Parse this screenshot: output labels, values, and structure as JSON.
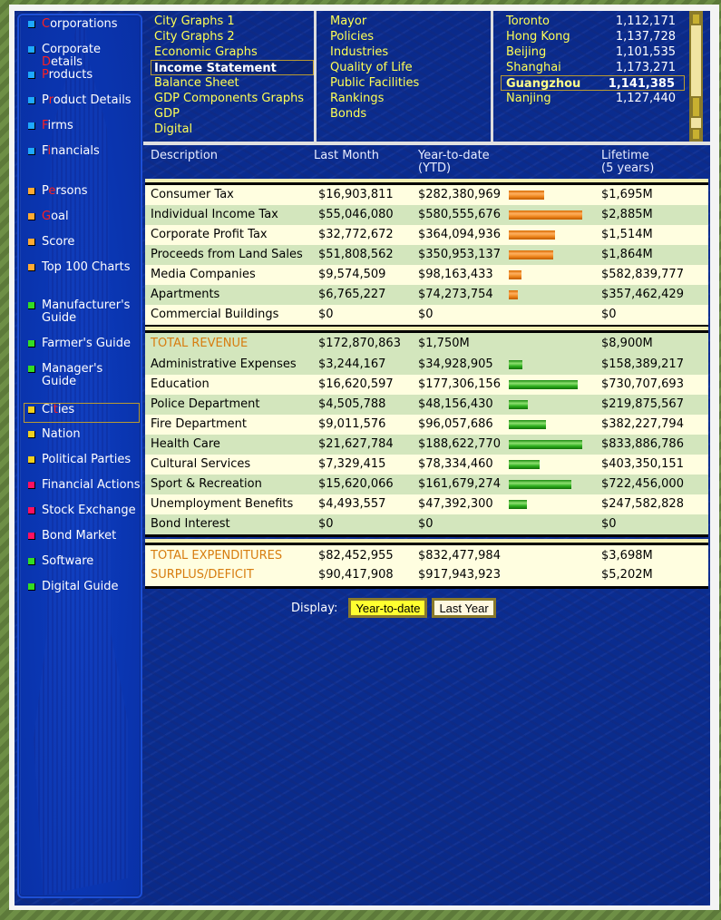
{
  "sidebar": {
    "items": [
      {
        "pre": "",
        "hl": "C",
        "post": "orporations",
        "color": "#1ea8ff"
      },
      {
        "pre": "Corporate ",
        "hl": "D",
        "post": "etails",
        "color": "#1ea8ff"
      },
      {
        "pre": "",
        "hl": "P",
        "post": "roducts",
        "color": "#1ea8ff"
      },
      {
        "pre": "P",
        "hl": "r",
        "post": "oduct Details",
        "color": "#1ea8ff"
      },
      {
        "pre": "",
        "hl": "F",
        "post": "irms",
        "color": "#1ea8ff"
      },
      {
        "pre": "F",
        "hl": "i",
        "post": "nancials",
        "color": "#1ea8ff"
      },
      {
        "pre": "P",
        "hl": "e",
        "post": "rsons",
        "color": "#ffaa33"
      },
      {
        "pre": "",
        "hl": "G",
        "post": "oal",
        "color": "#ffaa33"
      },
      {
        "pre": "Score",
        "hl": "",
        "post": "",
        "color": "#ffaa33"
      },
      {
        "pre": "Top 100 Charts",
        "hl": "",
        "post": "",
        "color": "#ffaa33"
      },
      {
        "pre": "Manufacturer's",
        "hl": "",
        "post": "",
        "line2": "Guide",
        "color": "#33dd22"
      },
      {
        "pre": "Farmer's Guide",
        "hl": "",
        "post": "",
        "color": "#33dd22"
      },
      {
        "pre": "Manager's Guide",
        "hl": "",
        "post": "",
        "color": "#33dd22"
      },
      {
        "pre": "Ci",
        "hl": "t",
        "post": "ies",
        "color": "#f0d020",
        "selected": true
      },
      {
        "pre": "Nation",
        "hl": "",
        "post": "",
        "color": "#f0d020"
      },
      {
        "pre": "Political Parties",
        "hl": "",
        "post": "",
        "color": "#f0d020"
      },
      {
        "pre": "Financial Actions",
        "hl": "",
        "post": "",
        "color": "#ff1060"
      },
      {
        "pre": "Stock Exchange",
        "hl": "",
        "post": "",
        "color": "#ff1060"
      },
      {
        "pre": "Bond Market",
        "hl": "",
        "post": "",
        "color": "#ff1060"
      },
      {
        "pre": "Software",
        "hl": "",
        "post": "",
        "color": "#33dd22"
      },
      {
        "pre": "Digital Guide",
        "hl": "",
        "post": "",
        "color": "#33dd22"
      }
    ]
  },
  "menus": {
    "reports": [
      "City Graphs 1",
      "City Graphs 2",
      "Economic Graphs",
      "Income Statement",
      "Balance Sheet",
      "GDP Components Graphs",
      "GDP",
      "Digital"
    ],
    "reports_selected": 3,
    "city_info": [
      "Mayor",
      "Policies",
      "Industries",
      "Quality of Life",
      "Public Facilities",
      "Rankings",
      "Bonds"
    ]
  },
  "cities": [
    {
      "name": "Toronto",
      "population": "1,112,171"
    },
    {
      "name": "Hong Kong",
      "population": "1,137,728"
    },
    {
      "name": "Beijing",
      "population": "1,101,535"
    },
    {
      "name": "Shanghai",
      "population": "1,173,271"
    },
    {
      "name": "Guangzhou",
      "population": "1,141,385",
      "selected": true
    },
    {
      "name": "Nanjing",
      "population": "1,127,440"
    }
  ],
  "table": {
    "headers": {
      "description": "Description",
      "last_month": "Last Month",
      "ytd_line1": "Year-to-date",
      "ytd_line2": "(YTD)",
      "lifetime_line1": "Lifetime",
      "lifetime_line2": "(5 years)"
    },
    "bar_max": 580555676,
    "revenue": [
      {
        "desc": "Consumer Tax",
        "last_month": "$16,903,811",
        "ytd": "$282,380,969",
        "ytd_value": 282380969,
        "lifetime": "$1,695M"
      },
      {
        "desc": "Individual Income Tax",
        "last_month": "$55,046,080",
        "ytd": "$580,555,676",
        "ytd_value": 580555676,
        "lifetime": "$2,885M"
      },
      {
        "desc": "Corporate Profit Tax",
        "last_month": "$32,772,672",
        "ytd": "$364,094,936",
        "ytd_value": 364094936,
        "lifetime": "$1,514M"
      },
      {
        "desc": "Proceeds from Land Sales",
        "last_month": "$51,808,562",
        "ytd": "$350,953,137",
        "ytd_value": 350953137,
        "lifetime": "$1,864M"
      },
      {
        "desc": "Media Companies",
        "last_month": "$9,574,509",
        "ytd": "$98,163,433",
        "ytd_value": 98163433,
        "lifetime": "$582,839,777"
      },
      {
        "desc": "Apartments",
        "last_month": "$6,765,227",
        "ytd": "$74,273,754",
        "ytd_value": 74273754,
        "lifetime": "$357,462,429"
      },
      {
        "desc": "Commercial Buildings",
        "last_month": "$0",
        "ytd": "$0",
        "ytd_value": 0,
        "lifetime": "$0"
      }
    ],
    "total_revenue": {
      "desc": "TOTAL REVENUE",
      "last_month": "$172,870,863",
      "ytd": "$1,750M",
      "lifetime": "$8,900M"
    },
    "expenditures": [
      {
        "desc": "Administrative Expenses",
        "last_month": "$3,244,167",
        "ytd": "$34,928,905",
        "ytd_value": 34928905,
        "lifetime": "$158,389,217"
      },
      {
        "desc": "Education",
        "last_month": "$16,620,597",
        "ytd": "$177,306,156",
        "ytd_value": 177306156,
        "lifetime": "$730,707,693"
      },
      {
        "desc": "Police Department",
        "last_month": "$4,505,788",
        "ytd": "$48,156,430",
        "ytd_value": 48156430,
        "lifetime": "$219,875,567"
      },
      {
        "desc": "Fire Department",
        "last_month": "$9,011,576",
        "ytd": "$96,057,686",
        "ytd_value": 96057686,
        "lifetime": "$382,227,794"
      },
      {
        "desc": "Health Care",
        "last_month": "$21,627,784",
        "ytd": "$188,622,770",
        "ytd_value": 188622770,
        "lifetime": "$833,886,786"
      },
      {
        "desc": "Cultural Services",
        "last_month": "$7,329,415",
        "ytd": "$78,334,460",
        "ytd_value": 78334460,
        "lifetime": "$403,350,151"
      },
      {
        "desc": "Sport & Recreation",
        "last_month": "$15,620,066",
        "ytd": "$161,679,274",
        "ytd_value": 161679274,
        "lifetime": "$722,456,000"
      },
      {
        "desc": "Unemployment Benefits",
        "last_month": "$4,493,557",
        "ytd": "$47,392,300",
        "ytd_value": 47392300,
        "lifetime": "$247,582,828"
      },
      {
        "desc": "Bond Interest",
        "last_month": "$0",
        "ytd": "$0",
        "ytd_value": 0,
        "lifetime": "$0"
      }
    ],
    "exp_bar_max": 188622770,
    "total_expenditures": {
      "desc": "TOTAL EXPENDITURES",
      "last_month": "$82,452,955",
      "ytd": "$832,477,984",
      "lifetime": "$3,698M"
    },
    "surplus": {
      "desc": "SURPLUS/DEFICIT",
      "last_month": "$90,417,908",
      "ytd": "$917,943,923",
      "lifetime": "$5,202M"
    }
  },
  "display": {
    "label": "Display:",
    "options": [
      "Year-to-date",
      "Last Year"
    ],
    "active": 0
  },
  "colors": {
    "menu_text": "#ffff55",
    "total_label": "#d77d10",
    "row_light": "#fffee0",
    "row_green": "#d3e6bd",
    "revenue_bar": "#f08a20",
    "expense_bar": "#30b020"
  }
}
